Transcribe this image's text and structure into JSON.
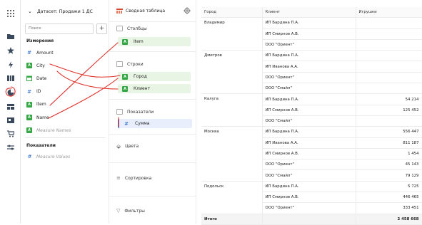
{
  "rail": {
    "icons": [
      "apps-icon",
      "folder-icon",
      "star-icon",
      "lightning-icon",
      "dashboards-icon",
      "charts-icon",
      "datasets-icon",
      "connections-icon",
      "cart-icon",
      "settings-icon"
    ]
  },
  "dataset": {
    "title": "Датасет: Продажи 1 ДС",
    "search_placeholder": "Поиск",
    "add_label": "+",
    "dimensions_title": "Измерения",
    "dimensions": [
      {
        "name": "Amount",
        "type": "measure"
      },
      {
        "name": "City",
        "type": "dimension"
      },
      {
        "name": "Date",
        "type": "date"
      },
      {
        "name": "ID",
        "type": "measure"
      },
      {
        "name": "Item",
        "type": "dimension"
      },
      {
        "name": "Name",
        "type": "dimension"
      },
      {
        "name": "Measure Names",
        "type": "dimension",
        "muted": true
      }
    ],
    "measures_title": "Показатели",
    "measures": [
      {
        "name": "Measure Values",
        "type": "measure",
        "muted": true
      }
    ]
  },
  "wizard": {
    "viz_type": "Сводная таблица",
    "sections": {
      "columns": "Столбцы",
      "rows": "Строки",
      "measures": "Показатели",
      "colors": "Цвета",
      "sort": "Сортировка",
      "filters": "Фильтры"
    },
    "columns_items": [
      "Item"
    ],
    "rows_items": [
      "Город",
      "Клиент"
    ],
    "measures_items": [
      "Сумма"
    ]
  },
  "table": {
    "headers": [
      "Город",
      "Клиент",
      "Игрушки"
    ],
    "groups": [
      {
        "city": "Владимир",
        "rows": [
          [
            "ИП Бардина П.А.",
            ""
          ],
          [
            "ИП Смирнов А.В.",
            ""
          ],
          [
            "ООО \"Ориент\"",
            ""
          ]
        ]
      },
      {
        "city": "Дмитров",
        "rows": [
          [
            "ИП Бардина П.А.",
            ""
          ],
          [
            "ИП Иванова А.А.",
            ""
          ],
          [
            "ООО \"Ориент\"",
            ""
          ],
          [
            "ООО \"Смайл\"",
            ""
          ]
        ]
      },
      {
        "city": "Калуга",
        "rows": [
          [
            "ИП Бардина П.А.",
            "54 214"
          ],
          [
            "ИП Смирнов А.В.",
            "125 452"
          ],
          [
            "ООО \"Смайл\"",
            ""
          ]
        ]
      },
      {
        "city": "Москва",
        "rows": [
          [
            "ИП Бардина П.А.",
            "556 447"
          ],
          [
            "ИП Иванова А.А.",
            "811 187"
          ],
          [
            "ИП Смирнов А.В.",
            "1 454"
          ],
          [
            "ООО \"Ориент\"",
            "45 143"
          ],
          [
            "ООО \"Смайл\"",
            "79 129"
          ]
        ]
      },
      {
        "city": "Подольск",
        "rows": [
          [
            "ИП Бардина П.А.",
            "5 725"
          ],
          [
            "ИП Смирнов А.В.",
            "446 465"
          ],
          [
            "ООО \"Ориент\"",
            "333 451"
          ]
        ]
      }
    ],
    "total_label": "Итого",
    "total_value": "2 458 668"
  },
  "colors": {
    "dimension": "#35a845",
    "measure": "#4a7fd6",
    "annotation": "#e0302a"
  }
}
